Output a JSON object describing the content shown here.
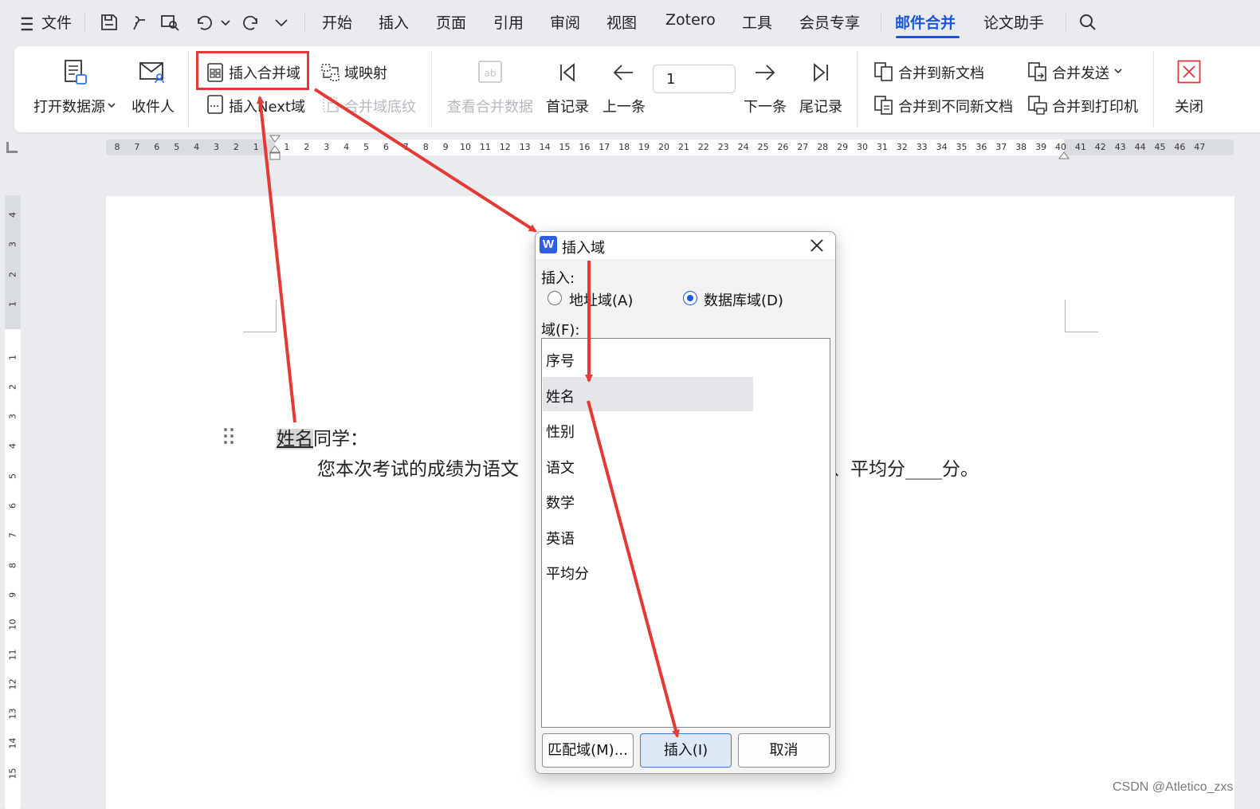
{
  "menubar": {
    "file": "文件",
    "tabs": [
      "开始",
      "插入",
      "页面",
      "引用",
      "审阅",
      "视图",
      "Zotero",
      "工具",
      "会员专享",
      "邮件合并",
      "论文助手"
    ],
    "active_tab": "邮件合并"
  },
  "ribbon": {
    "open_source": "打开数据源",
    "recipients": "收件人",
    "insert_merge_field": "插入合并域",
    "field_mapping": "域映射",
    "insert_next_field": "插入Next域",
    "merge_field_shading": "合并域底纹",
    "view_merge_data": "查看合并数据",
    "first_record": "首记录",
    "prev": "上一条",
    "record_number": "1",
    "next": "下一条",
    "last_record": "尾记录",
    "merge_new_doc": "合并到新文档",
    "merge_send": "合并发送",
    "merge_diff_docs": "合并到不同新文档",
    "merge_printer": "合并到打印机",
    "close": "关闭"
  },
  "hruler": [
    "8",
    "7",
    "6",
    "5",
    "4",
    "3",
    "2",
    "1",
    "1",
    "2",
    "3",
    "4",
    "5",
    "6",
    "7",
    "8",
    "9",
    "10",
    "11",
    "12",
    "13",
    "14",
    "15",
    "16",
    "17",
    "18",
    "19",
    "20",
    "21",
    "22",
    "23",
    "24",
    "25",
    "26",
    "27",
    "28",
    "29",
    "30",
    "31",
    "32",
    "33",
    "34",
    "35",
    "36",
    "37",
    "38",
    "39",
    "40",
    "41",
    "42",
    "43",
    "44",
    "45",
    "46",
    "47"
  ],
  "vruler": [
    "4",
    "3",
    "2",
    "1",
    "1",
    "2",
    "3",
    "4",
    "5",
    "6",
    "7",
    "8",
    "9",
    "10",
    "11",
    "12",
    "13",
    "14",
    "15"
  ],
  "document": {
    "field_name": "姓名",
    "line1_rest": "同学：",
    "line2_start": "您本次考试的成绩为语文",
    "line2_end": "、平均分____分。"
  },
  "dialog": {
    "title": "插入域",
    "insert_label": "插入:",
    "radio_address": "地址域(A)",
    "radio_database": "数据库域(D)",
    "selected_radio": "数据库域(D)",
    "field_label": "域(F):",
    "fields": [
      "序号",
      "姓名",
      "性别",
      "语文",
      "数学",
      "英语",
      "平均分"
    ],
    "selected_field": "姓名",
    "match_button": "匹配域(M)...",
    "insert_button": "插入(I)",
    "cancel_button": "取消"
  },
  "annotation_color": "#e53935",
  "accent_color": "#1a56d8",
  "watermark": "CSDN @Atletico_zxs"
}
